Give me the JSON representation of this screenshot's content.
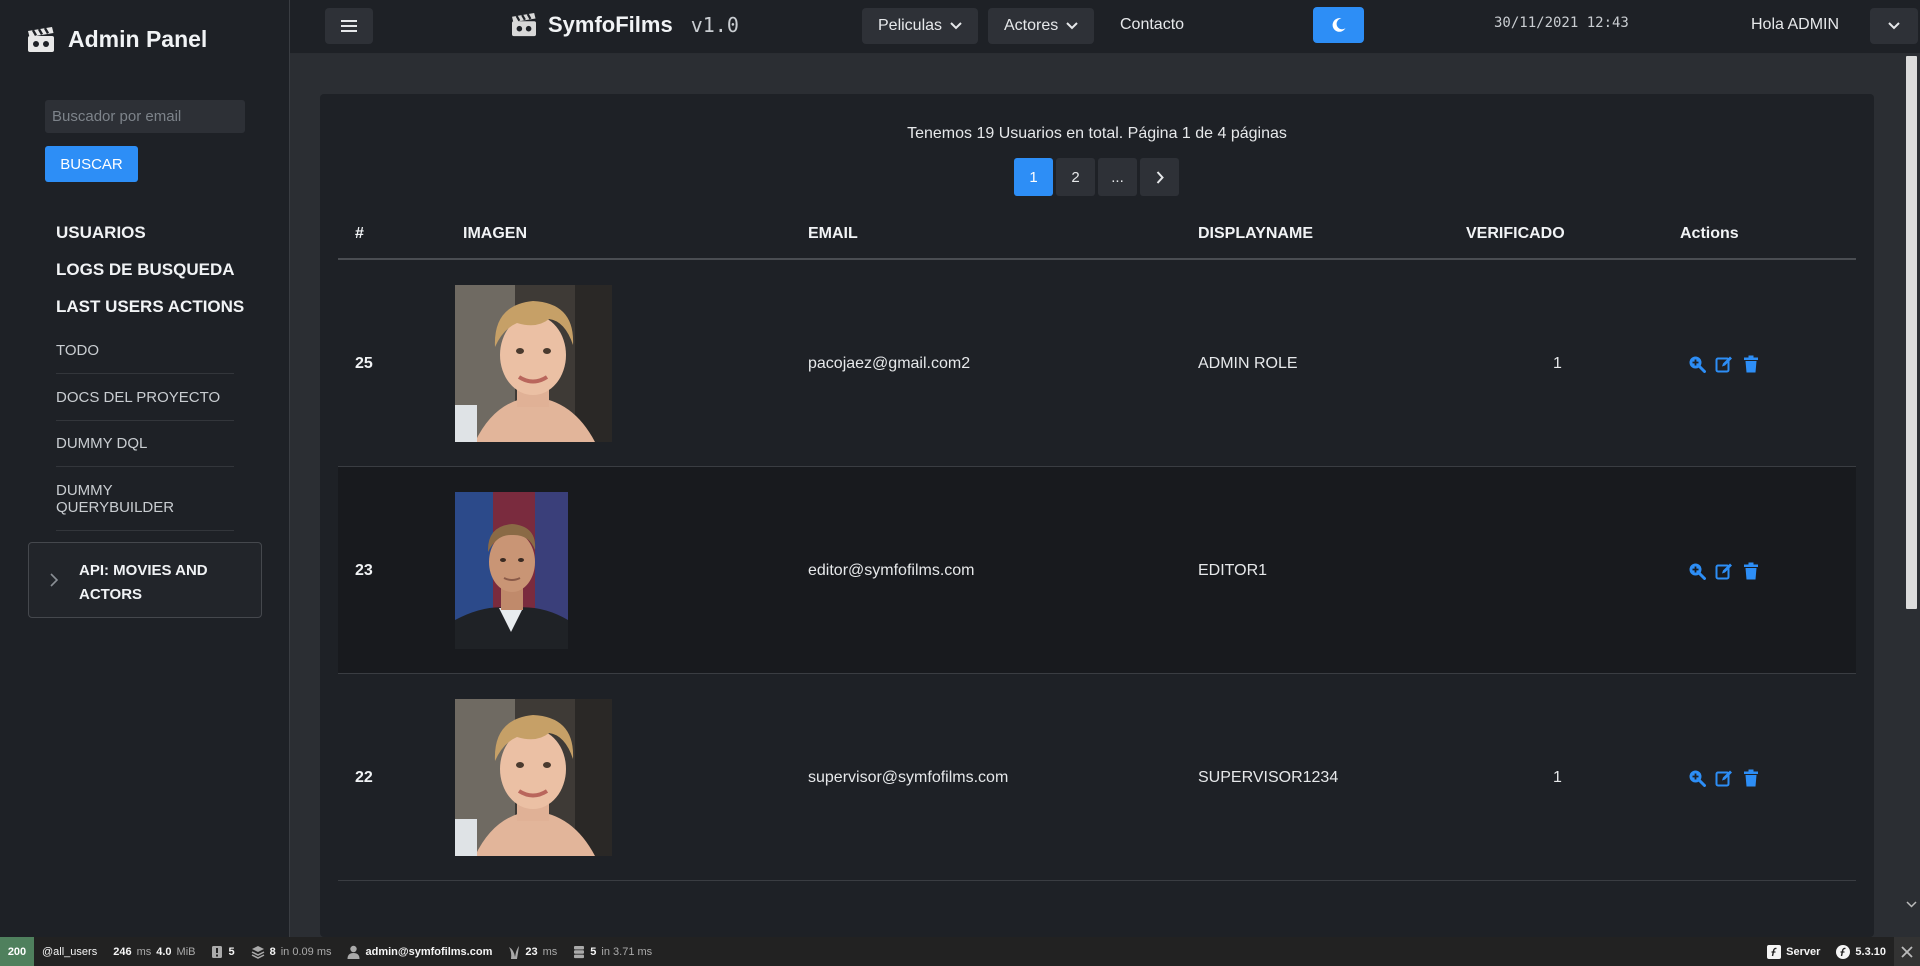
{
  "sidebar": {
    "brand": "Admin Panel",
    "search_placeholder": "Buscador por email",
    "search_button": "BUSCAR",
    "primary_nav": [
      "USUARIOS",
      "LOGS DE BUSQUEDA",
      "LAST USERS ACTIONS"
    ],
    "secondary_nav": [
      "TODO",
      "DOCS DEL PROYECTO",
      "DUMMY DQL",
      "DUMMY QUERYBUILDER"
    ],
    "api_section": "API: MOVIES AND ACTORS"
  },
  "topbar": {
    "site_name": "SymfoFilms",
    "version": "v1.0",
    "menu_peliculas": "Peliculas",
    "menu_actores": "Actores",
    "menu_contacto": "Contacto",
    "datetime": "30/11/2021 12:43",
    "greeting": "Hola ADMIN"
  },
  "main": {
    "summary": "Tenemos 19 Usuarios en total. Página 1 de 4 páginas",
    "pagination": {
      "pages": [
        "1",
        "2",
        "..."
      ],
      "active": "1"
    },
    "columns": {
      "id": "#",
      "image": "IMAGEN",
      "email": "EMAIL",
      "displayname": "DISPLAYNAME",
      "verified": "VERIFICADO",
      "actions": "Actions"
    },
    "rows": [
      {
        "id": "25",
        "email": "pacojaez@gmail.com2",
        "displayname": "ADMIN ROLE",
        "verified": "1",
        "portrait": "woman-curly-blonde-portrait"
      },
      {
        "id": "23",
        "email": "editor@symfofilms.com",
        "displayname": "EDITOR1",
        "verified": "",
        "portrait": "man-suit-portrait"
      },
      {
        "id": "22",
        "email": "supervisor@symfofilms.com",
        "displayname": "SUPERVISOR1234",
        "verified": "1",
        "portrait": "woman-curly-blonde-portrait"
      }
    ],
    "row_actions": [
      "zoom-icon",
      "edit-icon",
      "trash-icon"
    ]
  },
  "debugbar": {
    "status": "200",
    "route": "@all_users",
    "time": "246",
    "time_unit": "ms",
    "memory": "4.0",
    "memory_unit": "MiB",
    "logs": "5",
    "cache": "8",
    "cache_detail": "in 0.09 ms",
    "user": "admin@symfofilms.com",
    "twig": "23",
    "twig_unit": "ms",
    "db": "5",
    "db_detail": "in 3.71 ms",
    "server": "Server",
    "symfony_version": "5.3.10"
  },
  "colors": {
    "accent": "#2d8ef6",
    "sidebar_bg": "#1e2126",
    "page_bg": "#2b2e33",
    "debug_ok": "#4f805d"
  }
}
